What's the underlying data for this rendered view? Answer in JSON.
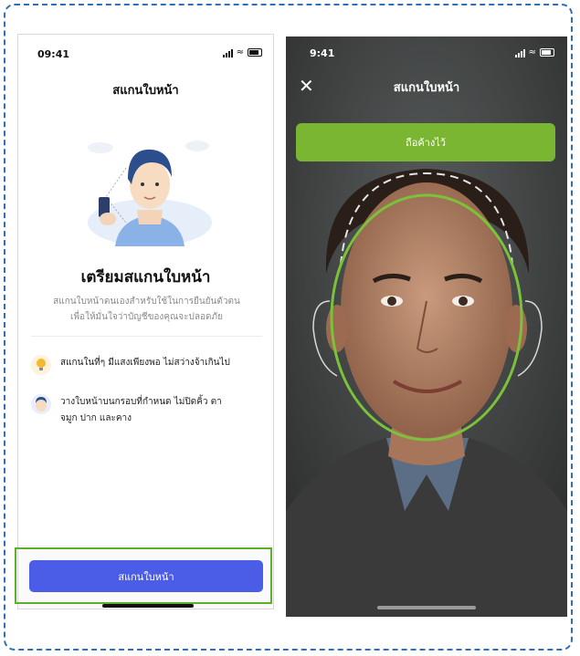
{
  "left_screen": {
    "status_time": "09:41",
    "title": "สแกนใบหน้า",
    "heading": "เตรียมสแกนใบหน้า",
    "description_lines": [
      "สแกนใบหน้าตนเองสำหรับใช้ในการยืนยันตัวตน",
      "เพื่อให้มั่นใจว่าบัญชีของคุณจะปลอดภัย"
    ],
    "tips": [
      {
        "icon": "lightbulb-icon",
        "text": "สแกนในที่ๆ มีแสงเพียงพอ ไม่สว่างจ้าเกินไป"
      },
      {
        "icon": "face-icon",
        "text_lines": [
          "วางใบหน้าบนกรอบที่กำหนด ไม่ปิดคิ้ว ตา",
          "จมูก ปาก และคาง"
        ]
      }
    ],
    "scan_button_label": "สแกนใบหน้า",
    "colors": {
      "button": "#4b5de6",
      "highlight": "#5cb02a"
    }
  },
  "right_screen": {
    "status_time": "9:41",
    "close_icon": "close-icon",
    "title": "สแกนใบหน้า",
    "hold_button_label": "ถือค้างไว้",
    "colors": {
      "hold_button": "#7bb632",
      "face_guide": "#7bc23a"
    }
  }
}
